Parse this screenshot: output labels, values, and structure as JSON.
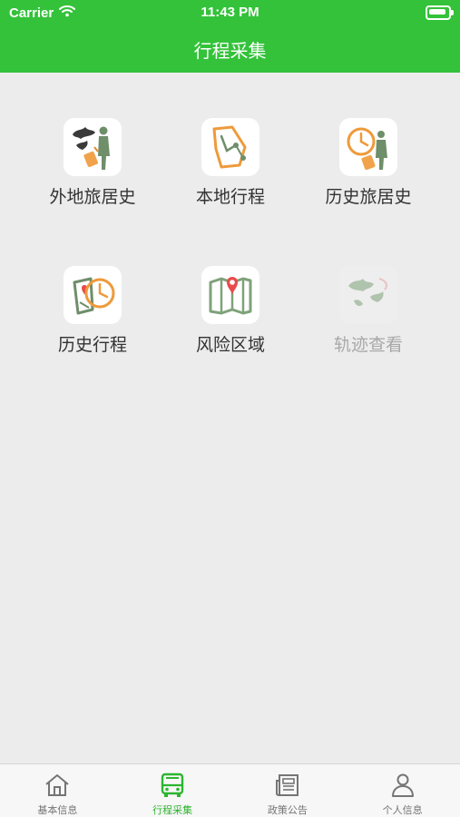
{
  "status_bar": {
    "carrier": "Carrier",
    "time": "11:43 PM"
  },
  "header": {
    "title": "行程采集",
    "color": "#33c23a"
  },
  "tiles": [
    {
      "label": "外地旅居史",
      "icon": "traveler-globe-icon",
      "enabled": true
    },
    {
      "label": "本地行程",
      "icon": "route-map-icon",
      "enabled": true
    },
    {
      "label": "历史旅居史",
      "icon": "traveler-clock-icon",
      "enabled": true
    },
    {
      "label": "历史行程",
      "icon": "map-clock-icon",
      "enabled": true
    },
    {
      "label": "风险区域",
      "icon": "risk-map-pin-icon",
      "enabled": true
    },
    {
      "label": "轨迹查看",
      "icon": "trajectory-world-map-icon",
      "enabled": false
    }
  ],
  "tabbar": {
    "items": [
      {
        "label": "基本信息",
        "icon": "home-icon",
        "active": false
      },
      {
        "label": "行程采集",
        "icon": "bus-icon",
        "active": true
      },
      {
        "label": "政策公告",
        "icon": "newspaper-icon",
        "active": false
      },
      {
        "label": "个人信息",
        "icon": "person-icon",
        "active": false
      }
    ],
    "active_color": "#2db52f",
    "inactive_color": "#757575"
  }
}
